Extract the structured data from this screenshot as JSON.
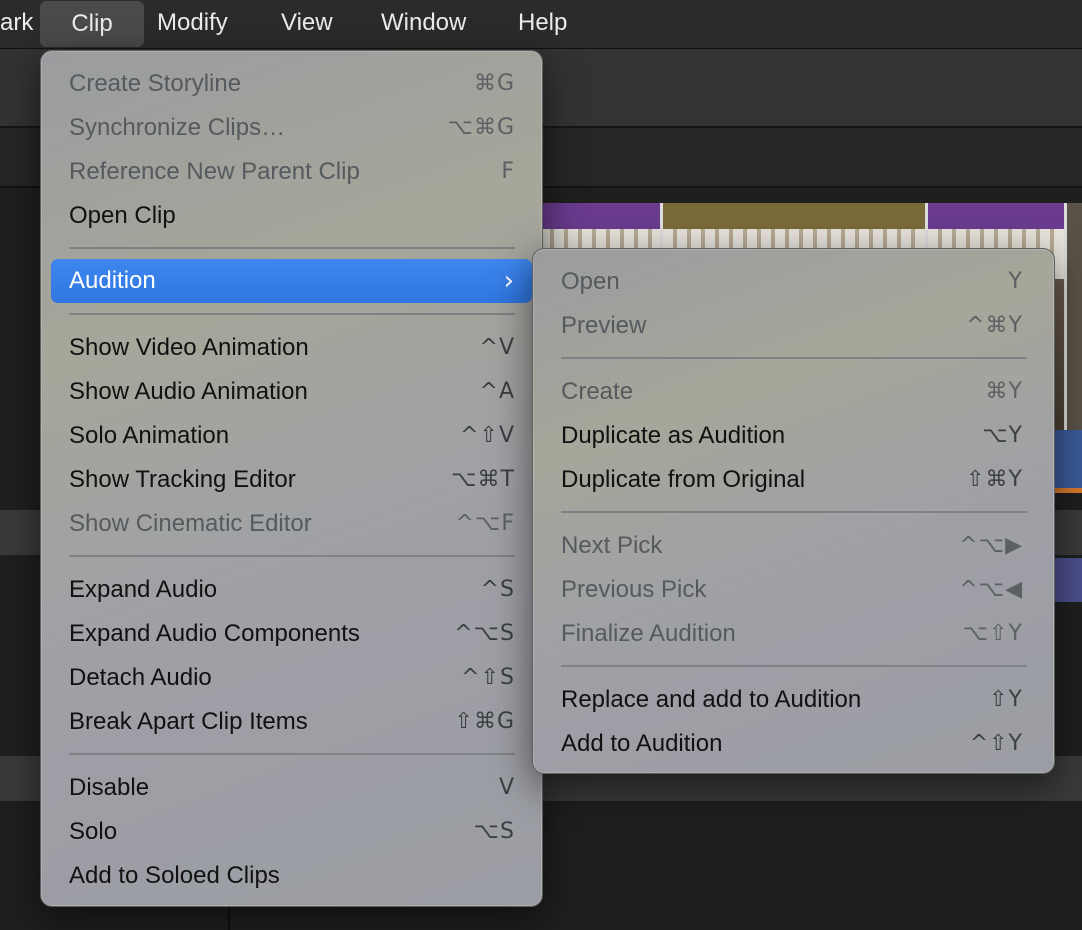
{
  "menubar": {
    "items": [
      "ark",
      "Clip",
      "Modify",
      "View",
      "Window",
      "Help"
    ],
    "active": "Clip"
  },
  "clip_menu": {
    "items": [
      {
        "label": "Create Storyline",
        "shortcut": "⌘G",
        "enabled": false
      },
      {
        "label": "Synchronize Clips…",
        "shortcut": "⌥⌘G",
        "enabled": false
      },
      {
        "label": "Reference New Parent Clip",
        "shortcut": "F",
        "enabled": false
      },
      {
        "label": "Open Clip",
        "shortcut": "",
        "enabled": true
      },
      {
        "label": "Audition",
        "shortcut": "",
        "enabled": true,
        "submenu": true,
        "highlighted": true
      },
      {
        "label": "Show Video Animation",
        "shortcut": "^V",
        "enabled": true
      },
      {
        "label": "Show Audio Animation",
        "shortcut": "^A",
        "enabled": true
      },
      {
        "label": "Solo Animation",
        "shortcut": "^⇧V",
        "enabled": true
      },
      {
        "label": "Show Tracking Editor",
        "shortcut": "⌥⌘T",
        "enabled": true
      },
      {
        "label": "Show Cinematic Editor",
        "shortcut": "^⌥F",
        "enabled": false
      },
      {
        "label": "Expand Audio",
        "shortcut": "^S",
        "enabled": true
      },
      {
        "label": "Expand Audio Components",
        "shortcut": "^⌥S",
        "enabled": true
      },
      {
        "label": "Detach Audio",
        "shortcut": "^⇧S",
        "enabled": true
      },
      {
        "label": "Break Apart Clip Items",
        "shortcut": "⇧⌘G",
        "enabled": true
      },
      {
        "label": "Disable",
        "shortcut": "V",
        "enabled": true
      },
      {
        "label": "Solo",
        "shortcut": "⌥S",
        "enabled": true
      },
      {
        "label": "Add to Soloed Clips",
        "shortcut": "",
        "enabled": true
      }
    ],
    "submenu_indicator": "›"
  },
  "audition_submenu": {
    "items": [
      {
        "label": "Open",
        "shortcut": "Y",
        "enabled": false
      },
      {
        "label": "Preview",
        "shortcut": "^⌘Y",
        "enabled": false
      },
      {
        "label": "Create",
        "shortcut": "⌘Y",
        "enabled": false
      },
      {
        "label": "Duplicate as Audition",
        "shortcut": "⌥Y",
        "enabled": true
      },
      {
        "label": "Duplicate from Original",
        "shortcut": "⇧⌘Y",
        "enabled": true
      },
      {
        "label": "Next Pick",
        "shortcut": "^⌥▶",
        "enabled": false
      },
      {
        "label": "Previous Pick",
        "shortcut": "^⌥◀",
        "enabled": false
      },
      {
        "label": "Finalize Audition",
        "shortcut": "⌥⇧Y",
        "enabled": false
      },
      {
        "label": "Replace and add to Audition",
        "shortcut": "⇧Y",
        "enabled": true
      },
      {
        "label": "Add to Audition",
        "shortcut": "^⇧Y",
        "enabled": true
      }
    ]
  },
  "colors": {
    "highlight": "#3e87f0",
    "menu_bg": "#9fa0a3",
    "menubar_bg": "#2b2b2b"
  }
}
